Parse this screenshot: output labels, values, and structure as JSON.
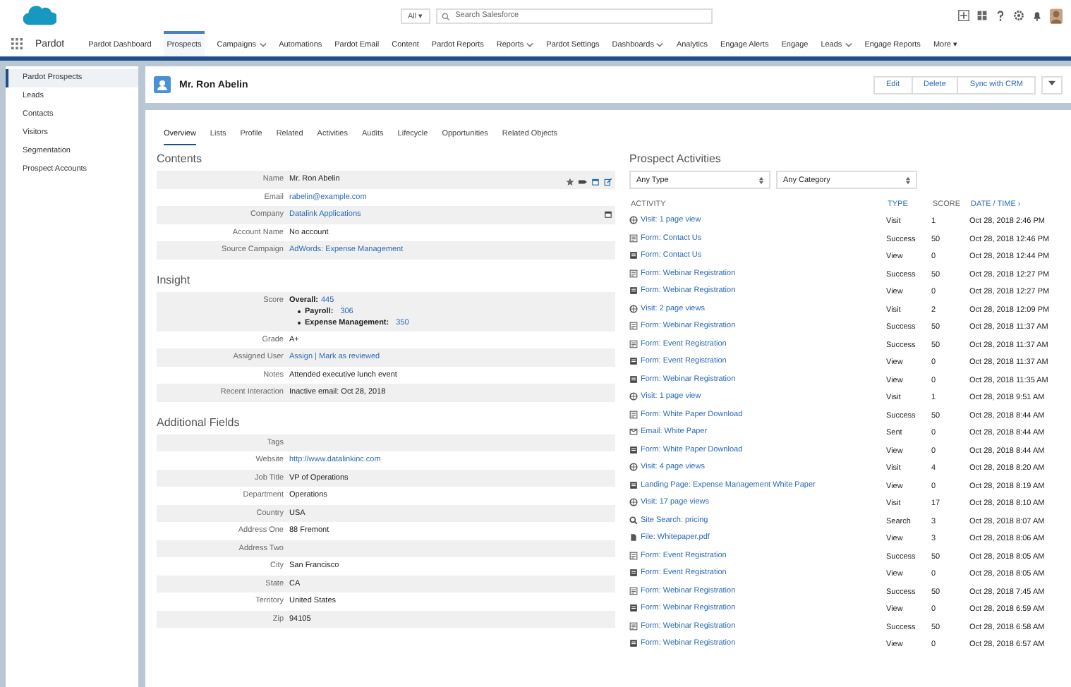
{
  "app_name": "Pardot",
  "search": {
    "scope": "All ▾",
    "placeholder": "Search Salesforce"
  },
  "nav": [
    {
      "label": "Pardot Dashboard",
      "selected": false,
      "menu": false
    },
    {
      "label": "Prospects",
      "selected": true,
      "menu": false
    },
    {
      "label": "Campaigns",
      "selected": false,
      "menu": true
    },
    {
      "label": "Automations",
      "selected": false,
      "menu": false
    },
    {
      "label": "Pardot Email",
      "selected": false,
      "menu": false
    },
    {
      "label": "Content",
      "selected": false,
      "menu": false
    },
    {
      "label": "Pardot Reports",
      "selected": false,
      "menu": false
    },
    {
      "label": "Reports",
      "selected": false,
      "menu": true
    },
    {
      "label": "Pardot Settings",
      "selected": false,
      "menu": false
    },
    {
      "label": "Dashboards",
      "selected": false,
      "menu": true
    },
    {
      "label": "Analytics",
      "selected": false,
      "menu": false
    },
    {
      "label": "Engage Alerts",
      "selected": false,
      "menu": false
    },
    {
      "label": "Engage",
      "selected": false,
      "menu": false
    },
    {
      "label": "Leads",
      "selected": false,
      "menu": true
    },
    {
      "label": "Engage Reports",
      "selected": false,
      "menu": false
    },
    {
      "label": "More ▾",
      "selected": false,
      "menu": false
    }
  ],
  "sidebar": {
    "items": [
      {
        "label": "Pardot Prospects",
        "selected": true
      },
      {
        "label": "Leads",
        "selected": false
      },
      {
        "label": "Contacts",
        "selected": false
      },
      {
        "label": "Visitors",
        "selected": false
      },
      {
        "label": "Segmentation",
        "selected": false
      },
      {
        "label": "Prospect Accounts",
        "selected": false
      }
    ]
  },
  "record": {
    "title": "Mr. Ron Abelin",
    "buttons": [
      "Edit",
      "Delete",
      "Sync with CRM"
    ]
  },
  "tabs": [
    {
      "label": "Overview",
      "selected": true
    },
    {
      "label": "Lists",
      "selected": false
    },
    {
      "label": "Profile",
      "selected": false
    },
    {
      "label": "Related",
      "selected": false
    },
    {
      "label": "Activities",
      "selected": false
    },
    {
      "label": "Audits",
      "selected": false
    },
    {
      "label": "Lifecycle",
      "selected": false
    },
    {
      "label": "Opportunities",
      "selected": false
    },
    {
      "label": "Related Objects",
      "selected": false
    }
  ],
  "sections": [
    {
      "title": "Contents",
      "fields": [
        {
          "label": "Name",
          "kind": "text",
          "value": "Mr. Ron Abelin"
        },
        {
          "label": "Email",
          "kind": "link",
          "value": "rabelin@example.com"
        },
        {
          "label": "Company",
          "kind": "link",
          "value": "Datalink Applications"
        },
        {
          "label": "Account Name",
          "kind": "text",
          "value": "No account"
        },
        {
          "label": "Source Campaign",
          "kind": "link",
          "value": "AdWords: Expense Management"
        }
      ]
    },
    {
      "title": "Insight",
      "fields": [
        {
          "label": "Score",
          "kind": "score",
          "parts": [
            {
              "name": "Overall:",
              "value": "445",
              "bullet": false
            },
            {
              "name": "Payroll:",
              "value": "306",
              "bullet": true
            },
            {
              "name": "Expense Management:",
              "value": "350",
              "bullet": true
            }
          ]
        },
        {
          "label": "Grade",
          "kind": "text",
          "value": "A+"
        },
        {
          "label": "Assigned User",
          "kind": "link",
          "value": "Assign | Mark as reviewed"
        },
        {
          "label": "Notes",
          "kind": "text",
          "value": "Attended executive lunch event"
        },
        {
          "label": "Recent Interaction",
          "kind": "text",
          "value": "Inactive email: Oct 28, 2018"
        }
      ]
    },
    {
      "title": "Additional Fields",
      "fields": [
        {
          "label": "Tags",
          "kind": "text"
        },
        {
          "label": "Website",
          "kind": "link",
          "value": "http://www.datalinkinc.com"
        },
        {
          "label": "Job Title",
          "kind": "text",
          "value": "VP of Operations"
        },
        {
          "label": "Department",
          "kind": "text",
          "value": "Operations"
        },
        {
          "label": "Country",
          "kind": "text",
          "value": "USA"
        },
        {
          "label": "Address One",
          "kind": "text",
          "value": "88 Fremont"
        },
        {
          "label": "Address Two",
          "kind": "text"
        },
        {
          "label": "City",
          "kind": "text",
          "value": "San Francisco"
        },
        {
          "label": "State",
          "kind": "text",
          "value": "CA"
        },
        {
          "label": "Territory",
          "kind": "text",
          "value": "United States"
        },
        {
          "label": "Zip",
          "kind": "text",
          "value": "94105"
        }
      ]
    }
  ],
  "activities": {
    "title": "Prospect Activities",
    "filters": [
      "Any Type",
      "Any Category"
    ],
    "columns": [
      "ACTIVITY",
      "TYPE",
      "SCORE",
      "DATE / TIME ›"
    ],
    "rows": [
      {
        "kind": "visit",
        "activity": "Visit: 1 page view",
        "type": "Visit",
        "score": "1",
        "date": "Oct 28, 2018 2:46 PM"
      },
      {
        "kind": "success",
        "activity": "Form: Contact Us",
        "type": "Success",
        "score": "50",
        "date": "Oct 28, 2018 12:46 PM"
      },
      {
        "kind": "view",
        "activity": "Form: Contact Us",
        "type": "View",
        "score": "0",
        "date": "Oct 28, 2018 12:44 PM"
      },
      {
        "kind": "success",
        "activity": "Form: Webinar Registration",
        "type": "Success",
        "score": "50",
        "date": "Oct 28, 2018 12:27 PM"
      },
      {
        "kind": "view",
        "activity": "Form: Webinar Registration",
        "type": "View",
        "score": "0",
        "date": "Oct 28, 2018 12:27 PM"
      },
      {
        "kind": "visit",
        "activity": "Visit: 2 page views",
        "type": "Visit",
        "score": "2",
        "date": "Oct 28, 2018 12:09 PM"
      },
      {
        "kind": "success",
        "activity": "Form: Webinar Registration",
        "type": "Success",
        "score": "50",
        "date": "Oct 28, 2018 11:37 AM"
      },
      {
        "kind": "success",
        "activity": "Form: Event Registration",
        "type": "Success",
        "score": "50",
        "date": "Oct 28, 2018 11:37 AM"
      },
      {
        "kind": "view",
        "activity": "Form: Event Registration",
        "type": "View",
        "score": "0",
        "date": "Oct 28, 2018 11:37 AM"
      },
      {
        "kind": "view",
        "activity": "Form: Webinar Registration",
        "type": "View",
        "score": "0",
        "date": "Oct 28, 2018 11:35 AM"
      },
      {
        "kind": "visit",
        "activity": "Visit: 1 page view",
        "type": "Visit",
        "score": "1",
        "date": "Oct 28, 2018 9:51 AM"
      },
      {
        "kind": "success",
        "activity": "Form: White Paper Download",
        "type": "Success",
        "score": "50",
        "date": "Oct 28, 2018 8:44 AM"
      },
      {
        "kind": "email",
        "activity": "Email: White Paper",
        "type": "Sent",
        "score": "0",
        "date": "Oct 28, 2018 8:44 AM"
      },
      {
        "kind": "view",
        "activity": "Form: White Paper Download",
        "type": "View",
        "score": "0",
        "date": "Oct 28, 2018 8:44 AM"
      },
      {
        "kind": "visit",
        "activity": "Visit: 4 page views",
        "type": "Visit",
        "score": "4",
        "date": "Oct 28, 2018 8:20 AM"
      },
      {
        "kind": "view",
        "activity": "Landing Page: Expense Management White Paper",
        "type": "View",
        "score": "0",
        "date": "Oct 28, 2018 8:19 AM"
      },
      {
        "kind": "visit",
        "activity": "Visit: 17 page views",
        "type": "Visit",
        "score": "17",
        "date": "Oct 28, 2018 8:10 AM"
      },
      {
        "kind": "search",
        "activity": "Site Search: pricing",
        "type": "Search",
        "score": "3",
        "date": "Oct 28, 2018 8:07 AM"
      },
      {
        "kind": "file",
        "activity": "File: Whitepaper.pdf",
        "type": "View",
        "score": "3",
        "date": "Oct 28, 2018 8:06 AM"
      },
      {
        "kind": "success",
        "activity": "Form: Event Registration",
        "type": "Success",
        "score": "50",
        "date": "Oct 28, 2018 8:05 AM"
      },
      {
        "kind": "view",
        "activity": "Form: Event Registration",
        "type": "View",
        "score": "0",
        "date": "Oct 28, 2018 8:05 AM"
      },
      {
        "kind": "success",
        "activity": "Form: Webinar Registration",
        "type": "Success",
        "score": "50",
        "date": "Oct 28, 2018 7:45 AM"
      },
      {
        "kind": "view",
        "activity": "Form: Webinar Registration",
        "type": "View",
        "score": "0",
        "date": "Oct 28, 2018 6:59 AM"
      },
      {
        "kind": "success",
        "activity": "Form: Webinar Registration",
        "type": "Success",
        "score": "50",
        "date": "Oct 28, 2018 6:58 AM"
      },
      {
        "kind": "view",
        "activity": "Form: Webinar Registration",
        "type": "View",
        "score": "0",
        "date": "Oct 28, 2018 6:57 AM"
      }
    ]
  }
}
